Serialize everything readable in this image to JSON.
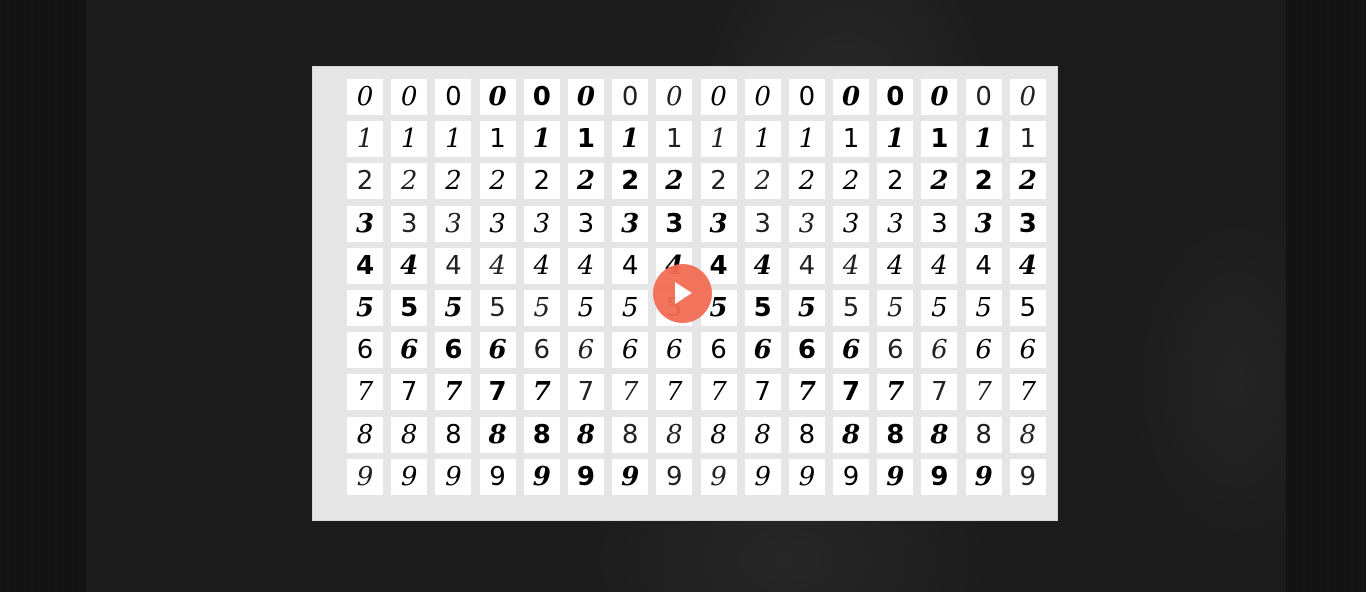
{
  "figure": {
    "rows": [
      [
        "0",
        "0",
        "0",
        "0",
        "0",
        "0",
        "0",
        "0",
        "0",
        "0",
        "0",
        "0",
        "0",
        "0",
        "0",
        "0"
      ],
      [
        "1",
        "1",
        "1",
        "1",
        "1",
        "1",
        "1",
        "1",
        "1",
        "1",
        "1",
        "1",
        "1",
        "1",
        "1",
        "1"
      ],
      [
        "2",
        "2",
        "2",
        "2",
        "2",
        "2",
        "2",
        "2",
        "2",
        "2",
        "2",
        "2",
        "2",
        "2",
        "2",
        "2"
      ],
      [
        "3",
        "3",
        "3",
        "3",
        "3",
        "3",
        "3",
        "3",
        "3",
        "3",
        "3",
        "3",
        "3",
        "3",
        "3",
        "3"
      ],
      [
        "4",
        "4",
        "4",
        "4",
        "4",
        "4",
        "4",
        "4",
        "4",
        "4",
        "4",
        "4",
        "4",
        "4",
        "4",
        "4"
      ],
      [
        "5",
        "5",
        "5",
        "5",
        "5",
        "5",
        "5",
        "5",
        "5",
        "5",
        "5",
        "5",
        "5",
        "5",
        "5",
        "5"
      ],
      [
        "6",
        "6",
        "6",
        "6",
        "6",
        "6",
        "6",
        "6",
        "6",
        "6",
        "6",
        "6",
        "6",
        "6",
        "6",
        "6"
      ],
      [
        "7",
        "7",
        "7",
        "7",
        "7",
        "7",
        "7",
        "7",
        "7",
        "7",
        "7",
        "7",
        "7",
        "7",
        "7",
        "7"
      ],
      [
        "8",
        "8",
        "8",
        "8",
        "8",
        "8",
        "8",
        "8",
        "8",
        "8",
        "8",
        "8",
        "8",
        "8",
        "8",
        "8"
      ],
      [
        "9",
        "9",
        "9",
        "9",
        "9",
        "9",
        "9",
        "9",
        "9",
        "9",
        "9",
        "9",
        "9",
        "9",
        "9",
        "9"
      ]
    ]
  },
  "player": {
    "play_icon": "play-icon",
    "accent_color": "#f26d55"
  }
}
